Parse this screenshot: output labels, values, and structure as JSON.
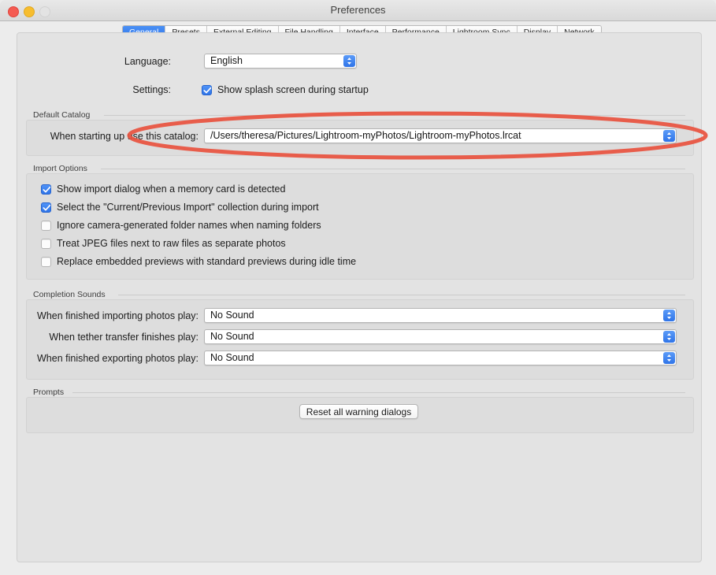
{
  "window": {
    "title": "Preferences",
    "traffic_lights": [
      "close",
      "minimize",
      "zoom"
    ]
  },
  "tabs": [
    {
      "label": "General",
      "active": true
    },
    {
      "label": "Presets",
      "active": false
    },
    {
      "label": "External Editing",
      "active": false
    },
    {
      "label": "File Handling",
      "active": false
    },
    {
      "label": "Interface",
      "active": false
    },
    {
      "label": "Performance",
      "active": false
    },
    {
      "label": "Lightroom Sync",
      "active": false
    },
    {
      "label": "Display",
      "active": false
    },
    {
      "label": "Network",
      "active": false
    }
  ],
  "general": {
    "language_label": "Language:",
    "language_value": "English",
    "settings_label": "Settings:",
    "splash_checkbox_label": "Show splash screen during startup",
    "splash_checked": true
  },
  "default_catalog": {
    "group_title": "Default Catalog",
    "row_label": "When starting up use this catalog:",
    "catalog_value": "/Users/theresa/Pictures/Lightroom-myPhotos/Lightroom-myPhotos.lrcat"
  },
  "import_options": {
    "group_title": "Import Options",
    "items": [
      {
        "label": "Show import dialog when a memory card is detected",
        "checked": true
      },
      {
        "label": "Select the \"Current/Previous Import\" collection during import",
        "checked": true
      },
      {
        "label": "Ignore camera-generated folder names when naming folders",
        "checked": false
      },
      {
        "label": "Treat JPEG files next to raw files as separate photos",
        "checked": false
      },
      {
        "label": "Replace embedded previews with standard previews during idle time",
        "checked": false
      }
    ]
  },
  "completion_sounds": {
    "group_title": "Completion Sounds",
    "rows": [
      {
        "label": "When finished importing photos play:",
        "value": "No Sound"
      },
      {
        "label": "When tether transfer finishes play:",
        "value": "No Sound"
      },
      {
        "label": "When finished exporting photos play:",
        "value": "No Sound"
      }
    ]
  },
  "prompts": {
    "group_title": "Prompts",
    "reset_button_label": "Reset all warning dialogs"
  },
  "annotation": {
    "shape": "ellipse",
    "color": "#e8533f",
    "target": "default-catalog-row"
  }
}
